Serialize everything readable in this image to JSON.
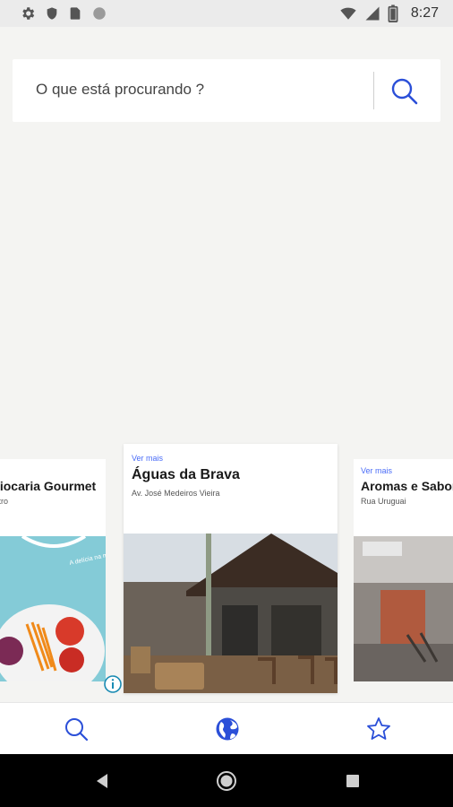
{
  "status_bar": {
    "time": "8:27",
    "left_icons": [
      "settings-icon",
      "shield-icon",
      "sim-card-icon",
      "circle-icon"
    ],
    "right_icons": [
      "wifi-icon",
      "signal-icon",
      "battery-icon"
    ]
  },
  "search": {
    "placeholder": "O que está procurando ?",
    "button_icon": "search-icon"
  },
  "cards": {
    "left": {
      "title": "Tapiocaria Gourmet",
      "address": "Centro",
      "photo_caption": "A delícia na medida certa"
    },
    "center": {
      "more_label": "Ver mais",
      "title": "Águas da Brava",
      "address": "Av. José Medeiros Vieira"
    },
    "right": {
      "more_label": "Ver mais",
      "title": "Aromas e Sabores",
      "address": "Rua Uruguai"
    }
  },
  "bottom_nav": {
    "items": [
      {
        "icon": "search-icon",
        "active": false
      },
      {
        "icon": "globe-icon",
        "active": true
      },
      {
        "icon": "star-icon",
        "active": false
      }
    ]
  },
  "system_nav": [
    "back-icon",
    "home-icon",
    "recents-icon"
  ],
  "colors": {
    "accent": "#2b4fd8",
    "link": "#4a6cf7",
    "background": "#f4f4f2"
  }
}
